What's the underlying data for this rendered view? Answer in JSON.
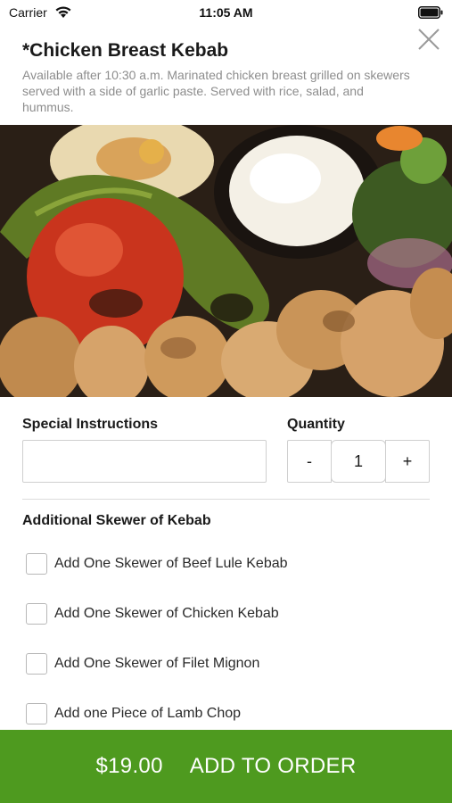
{
  "status_bar": {
    "carrier": "Carrier",
    "time": "11:05 AM"
  },
  "item": {
    "title": "*Chicken Breast Kebab",
    "description": "Available after 10:30 a.m. Marinated chicken breast grilled on skewers served with a side of garlic paste. Served with rice, salad, and hummus."
  },
  "special_instructions": {
    "label": "Special Instructions",
    "value": "",
    "placeholder": ""
  },
  "quantity": {
    "label": "Quantity",
    "minus": "-",
    "value": "1",
    "plus": "+"
  },
  "options_section": {
    "title": "Additional Skewer of Kebab",
    "options": [
      {
        "label": "Add One Skewer of Beef Lule Kebab",
        "checked": false
      },
      {
        "label": "Add One Skewer of Chicken Kebab",
        "checked": false
      },
      {
        "label": "Add One Skewer of Filet Mignon",
        "checked": false
      },
      {
        "label": "Add one Piece of Lamb Chop",
        "checked": false
      }
    ]
  },
  "order_bar": {
    "price": "$19.00",
    "label": "ADD TO ORDER"
  },
  "colors": {
    "accent_green": "#4e9a1f",
    "description_gray": "#8d8d8d"
  },
  "icons": [
    "wifi-icon",
    "battery-icon",
    "close-icon",
    "food-photo"
  ]
}
